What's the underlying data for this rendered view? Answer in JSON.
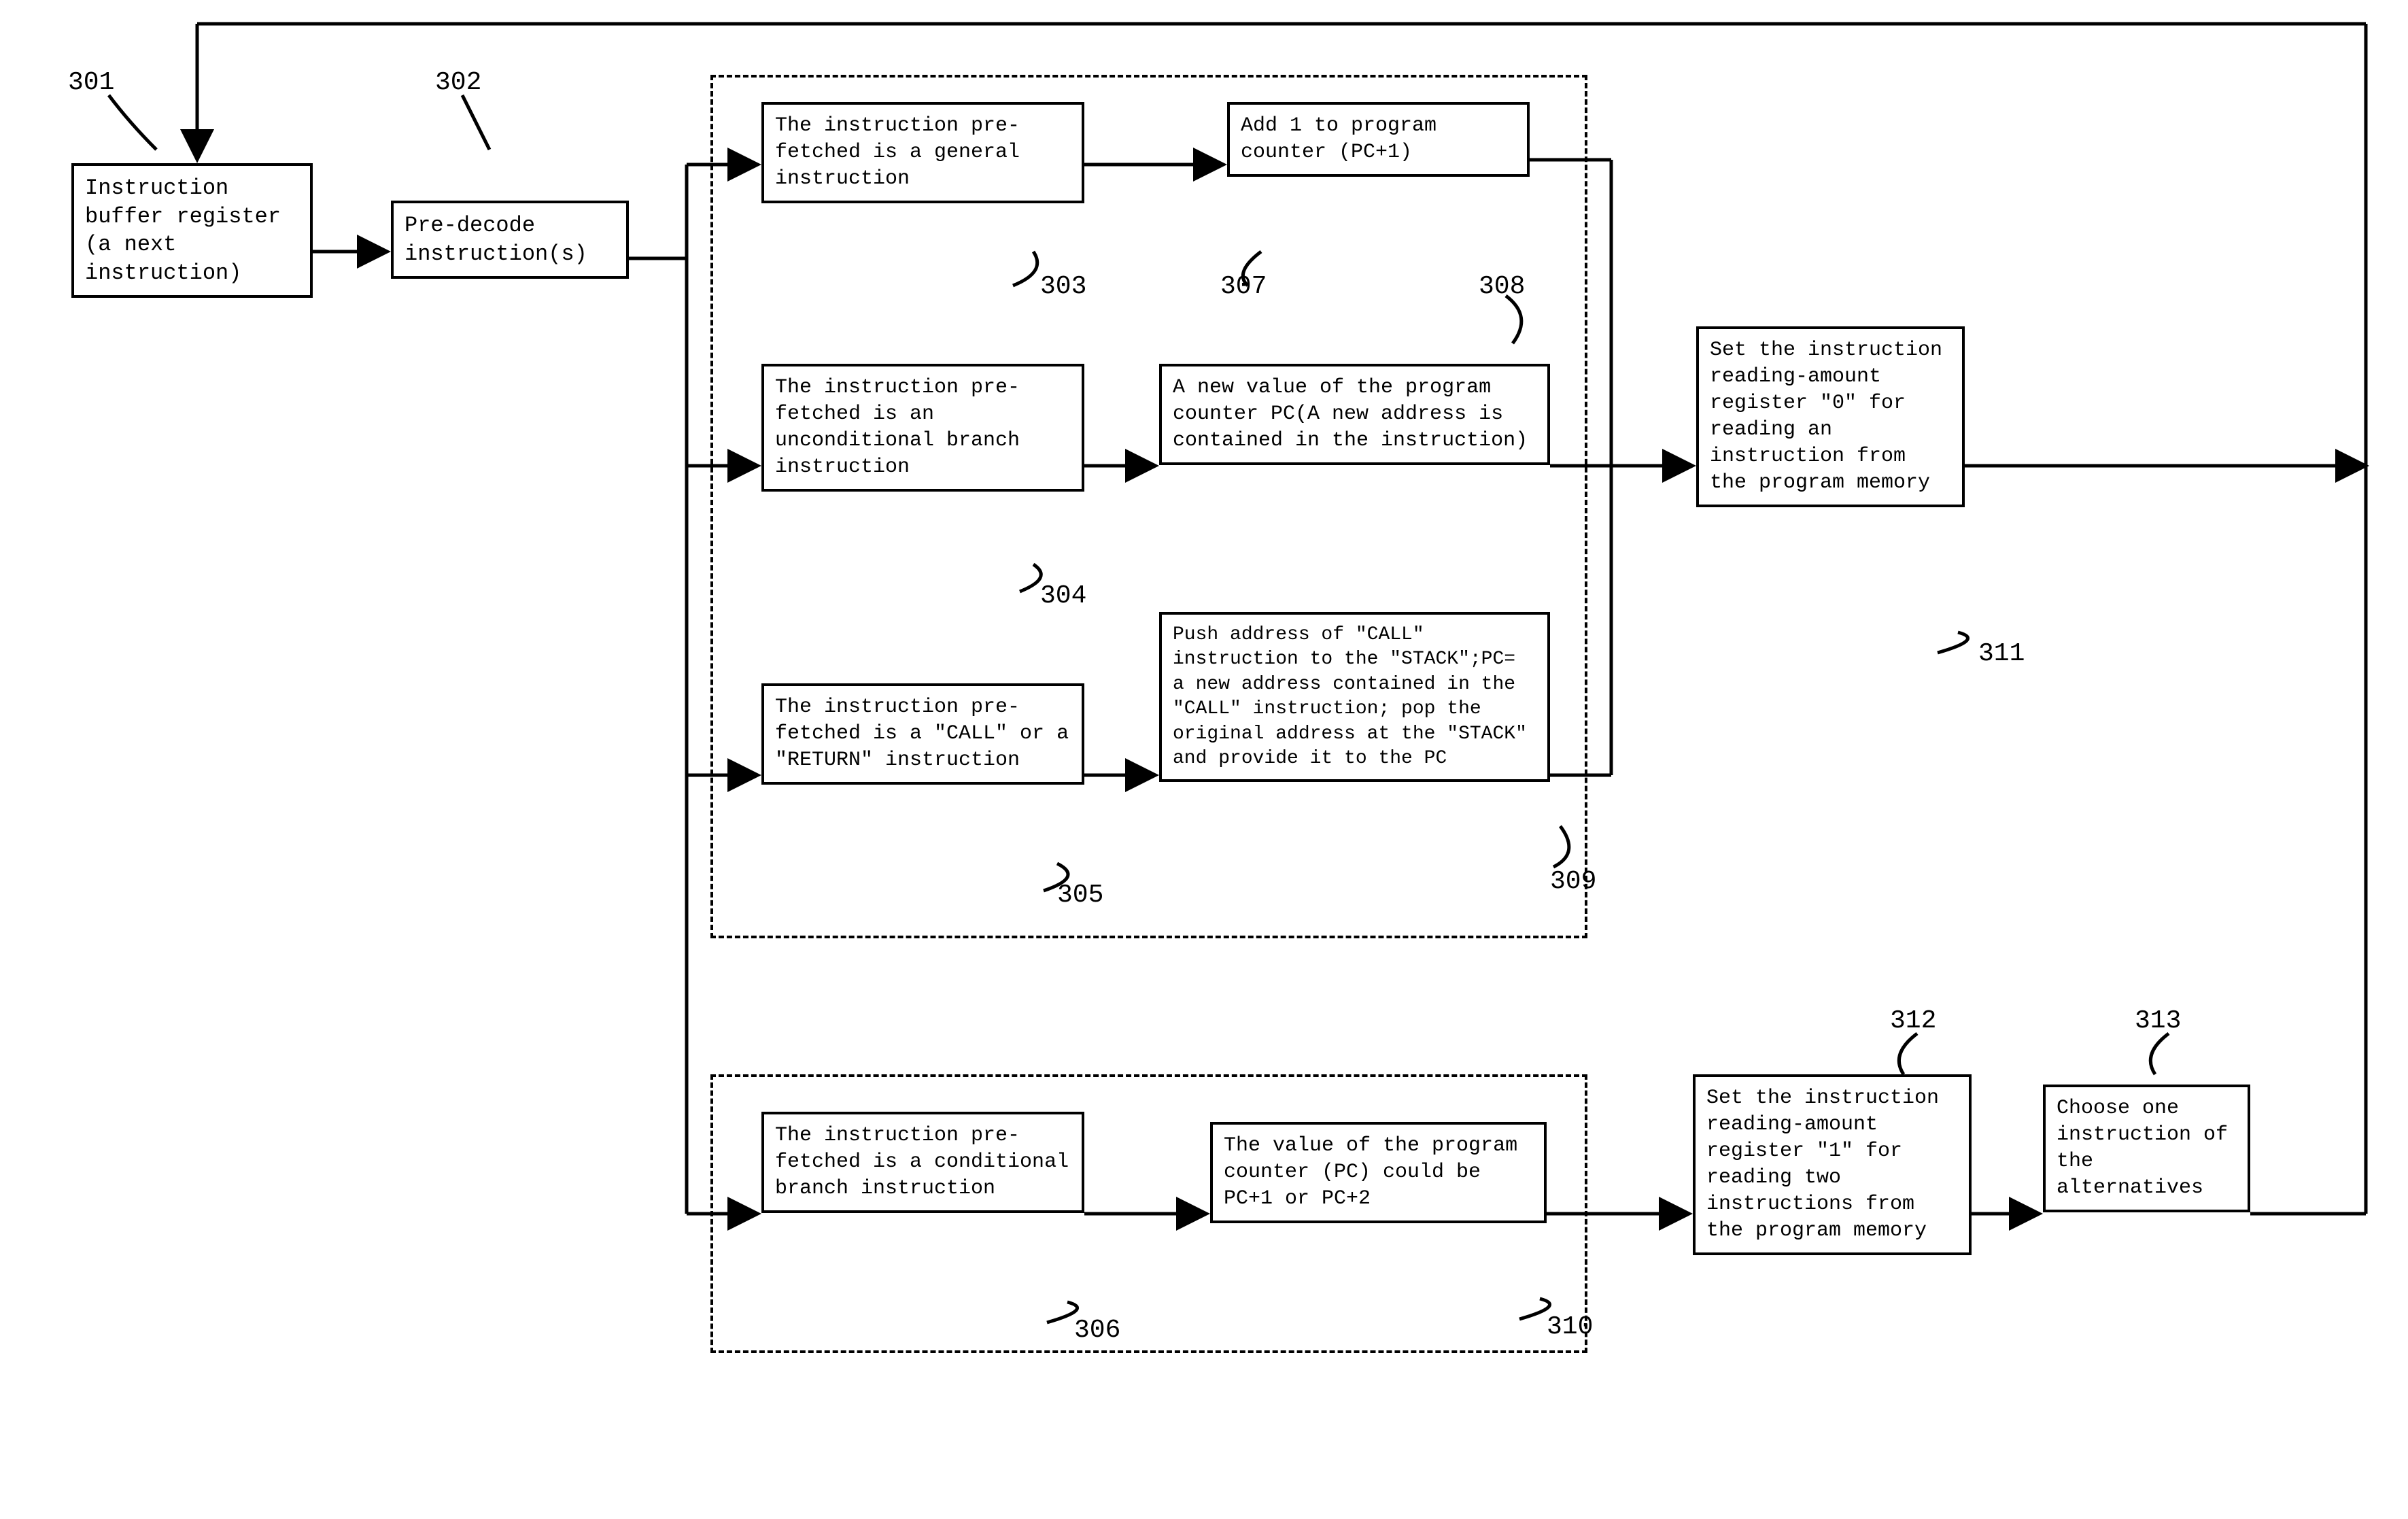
{
  "labels": {
    "n301": "301",
    "n302": "302",
    "n303": "303",
    "n304": "304",
    "n305": "305",
    "n306": "306",
    "n307": "307",
    "n308": "308",
    "n309": "309",
    "n310": "310",
    "n311": "311",
    "n312": "312",
    "n313": "313"
  },
  "boxes": {
    "b301": "Instruction buffer register (a next instruction)",
    "b302": "Pre-decode instruction(s)",
    "b303": "The instruction pre-fetched is a general instruction",
    "b304": "The instruction pre-fetched is an unconditional branch instruction",
    "b305": "The instruction pre-fetched is a \"CALL\" or a \"RETURN\" instruction",
    "b306": "The instruction pre-fetched is a conditional branch instruction",
    "b307": "Add 1 to program counter (PC+1)",
    "b308": "A new value of the program counter PC(A new address is contained in the instruction)",
    "b309": "Push address of \"CALL\" instruction to the \"STACK\";PC= a new address contained in the \"CALL\" instruction; pop the original address at the \"STACK\" and provide it to the PC",
    "b310": "The value of the program counter (PC) could be PC+1 or PC+2",
    "b311": "Set the instruction reading-amount register \"0\" for reading an instruction from the program memory",
    "b312": "Set the instruction reading-amount register \"1\" for reading two instructions from the program memory",
    "b313": "Choose one instruction of the alternatives"
  }
}
